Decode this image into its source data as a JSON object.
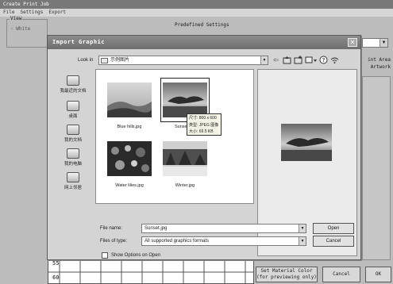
{
  "app": {
    "title": "Create Print Job",
    "menu": [
      "File",
      "Settings",
      "Export"
    ],
    "view_label": "View",
    "view_option": "White",
    "predefined_label": "Predefined Settings",
    "print_area_line1": "int Area",
    "print_area_line2": "Artwork",
    "ruler_top": "55",
    "ruler_bottom": "60",
    "set_material_line1": "Set Material Color",
    "set_material_line2": "(for previewing only)",
    "cancel_label": "Cancel",
    "ok_label": "OK"
  },
  "dialog": {
    "title": "Import Graphic",
    "close_glyph": "✕",
    "look_in_label": "Look in",
    "look_in_value": "示例图片",
    "places": [
      {
        "label": "我最近的文档"
      },
      {
        "label": "桌面"
      },
      {
        "label": "我的文档"
      },
      {
        "label": "我的电脑"
      },
      {
        "label": "网上邻居"
      }
    ],
    "files": [
      {
        "name": "Blue hills.jpg"
      },
      {
        "name": "Sunset.jpg"
      },
      {
        "name": "Water lilies.jpg"
      },
      {
        "name": "Winter.jpg"
      }
    ],
    "tooltip": {
      "line1": "尺寸: 800 x 600",
      "line2": "类型: JPEG 图像",
      "line3": "大小: 69.5 KB"
    },
    "file_name_label": "File name:",
    "file_name_value": "Sunset.jpg",
    "file_type_label": "Files of type:",
    "file_type_value": "All supported graphics formats",
    "open_label": "Open",
    "cancel_label": "Cancel",
    "show_options_label": "Show Options on Open",
    "show_options_checked": false
  },
  "icons": {
    "folder": "folder-icon",
    "back": "back-arrow-icon",
    "up": "up-folder-icon",
    "new_folder": "new-folder-icon",
    "views": "views-menu-icon",
    "dropdown": "chevron-down-icon"
  }
}
